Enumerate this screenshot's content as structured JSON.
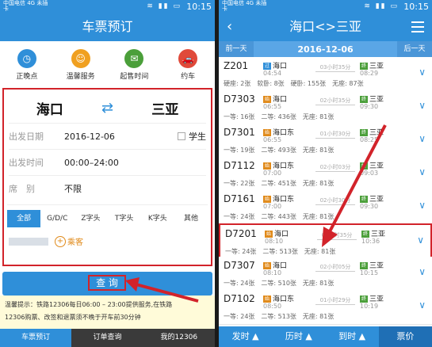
{
  "left": {
    "status": {
      "carrier": "中国电信 4G 未插卡",
      "time": "10:15"
    },
    "title": "车票预订",
    "quick": [
      {
        "label": "正晚点",
        "icon": "clock-icon",
        "color": "#2f8fd9",
        "glyph": "◷"
      },
      {
        "label": "温馨服务",
        "icon": "service-icon",
        "color": "#f0a020",
        "glyph": "☺"
      },
      {
        "label": "起售时间",
        "icon": "ticket-icon",
        "color": "#4b9f3a",
        "glyph": "✉"
      },
      {
        "label": "约车",
        "icon": "car-icon",
        "color": "#e04a3a",
        "glyph": "🚗"
      }
    ],
    "from_city": "海口",
    "to_city": "三亚",
    "swap_glyph": "⇄",
    "depart_date_label": "出发日期",
    "depart_date": "2016-12-06",
    "student_label": "学生",
    "depart_time_label": "出发时间",
    "depart_time": "00:00–24:00",
    "seat_label": "席　别",
    "seat_value": "不限",
    "tabs": [
      "全部",
      "G/D/C",
      "Z字头",
      "T字头",
      "K字头",
      "其他"
    ],
    "add_passenger": "乘客",
    "query_button": "查 询",
    "notice_line1": "温馨提示：铁路12306每日06:00 – 23:00提供服务,在铁路",
    "notice_line2": "12306购票、改签和退票须不晚于开车前30分钟",
    "nav": [
      "车票预订",
      "订单查询",
      "我的12306"
    ]
  },
  "right": {
    "status": {
      "carrier": "中国电信 4G 未插卡",
      "time": "10:15"
    },
    "title": "海口<>三亚",
    "prev_day": "前一天",
    "date": "2016-12-06",
    "next_day": "后一天",
    "trains": [
      {
        "no": "Z201",
        "ftag": "过",
        "from": "海口",
        "ftime": "04:54",
        "dur": "03小时35分",
        "ttag": "终",
        "to": "三亚",
        "ttime": "08:29",
        "seats": "硬座: 2张　软卧: 8张　硬卧: 155张　无座: 87张"
      },
      {
        "no": "D7303",
        "ftag": "始",
        "from": "海口",
        "ftime": "06:55",
        "dur": "02小时35分",
        "ttag": "终",
        "to": "三亚",
        "ttime": "09:30",
        "seats": "一等: 16张　二等: 436张　无座: 81张"
      },
      {
        "no": "D7301",
        "ftag": "始",
        "from": "海口东",
        "ftime": "06:55",
        "dur": "01小时30分",
        "ttag": "终",
        "to": "三亚",
        "ttime": "08:25",
        "seats": "一等: 19张　二等: 493张　无座: 81张"
      },
      {
        "no": "D7112",
        "ftag": "始",
        "from": "海口东",
        "ftime": "07:00",
        "dur": "02小时03分",
        "ttag": "终",
        "to": "三亚",
        "ttime": "09:03",
        "seats": "一等: 22张　二等: 451张　无座: 81张"
      },
      {
        "no": "D7161",
        "ftag": "始",
        "from": "海口东",
        "ftime": "07:00",
        "dur": "02小时30分",
        "ttag": "终",
        "to": "三亚",
        "ttime": "09:30",
        "seats": "一等: 24张　二等: 443张　无座: 81张"
      },
      {
        "no": "D7201",
        "ftag": "始",
        "from": "海口",
        "ftime": "08:10",
        "dur": "02小时35分",
        "ttag": "终",
        "to": "三亚",
        "ttime": "10:36",
        "seats": "一等: 24张　二等: 513张　无座: 81张"
      },
      {
        "no": "D7307",
        "ftag": "始",
        "from": "海口",
        "ftime": "08:10",
        "dur": "02小时05分",
        "ttag": "终",
        "to": "三亚",
        "ttime": "10:15",
        "seats": "一等: 24张　二等: 510张　无座: 81张"
      },
      {
        "no": "D7102",
        "ftag": "始",
        "from": "海口东",
        "ftime": "08:50",
        "dur": "01小时29分",
        "ttag": "终",
        "to": "三亚",
        "ttime": "10:19",
        "seats": "一等: 24张　二等: 513张　无座: 81张"
      }
    ],
    "bottom": [
      "发时 ▲",
      "历时 ▲",
      "到时 ▲",
      "票价"
    ]
  }
}
